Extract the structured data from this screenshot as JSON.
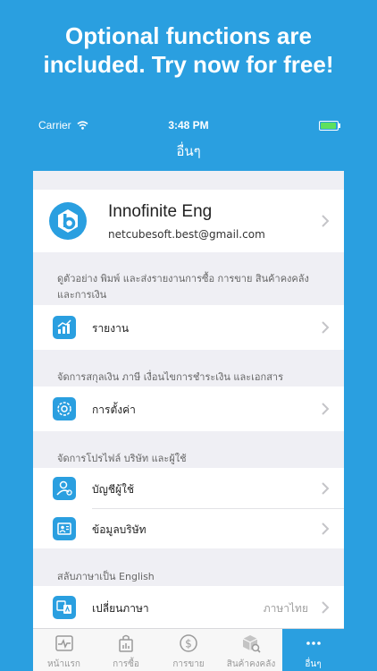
{
  "promo": {
    "line1": "Optional functions are",
    "line2": "included. Try now for free!"
  },
  "status_bar": {
    "carrier": "Carrier",
    "time": "3:48 PM"
  },
  "nav": {
    "title": "อื่นๆ"
  },
  "profile": {
    "name": "Innofinite Eng",
    "email": "netcubesoft.best@gmail.com",
    "avatar_icon": "b-logo-icon"
  },
  "sections": {
    "reports": {
      "label": "ดูตัวอย่าง พิมพ์ และส่งรายงานการซื้อ การขาย สินค้าคงคลัง และการเงิน",
      "rows": [
        {
          "title": "รายงาน",
          "icon": "chart-icon"
        }
      ]
    },
    "settings": {
      "label": "จัดการสกุลเงิน ภาษี เงื่อนไขการชำระเงิน และเอกสาร",
      "rows": [
        {
          "title": "การตั้งค่า",
          "icon": "gear-icon"
        }
      ]
    },
    "profiles": {
      "label": "จัดการโปรไฟล์ บริษัท และผู้ใช้",
      "rows": [
        {
          "title": "บัญชีผู้ใช้",
          "icon": "user-account-icon"
        },
        {
          "title": "ข้อมูลบริษัท",
          "icon": "company-info-icon"
        }
      ]
    },
    "language": {
      "label": "สลับภาษาเป็น English",
      "rows": [
        {
          "title": "เปลี่ยนภาษา",
          "value": "ภาษาไทย",
          "icon": "language-icon"
        }
      ]
    }
  },
  "tabs": [
    {
      "label": "หน้าแรก",
      "icon": "dashboard-icon",
      "active": false
    },
    {
      "label": "การซื้อ",
      "icon": "shopping-bag-icon",
      "active": false
    },
    {
      "label": "การขาย",
      "icon": "dollar-icon",
      "active": false
    },
    {
      "label": "สินค้าคงคลัง",
      "icon": "inventory-box-icon",
      "active": false
    },
    {
      "label": "อื่นๆ",
      "icon": "more-dots-icon",
      "active": true
    }
  ],
  "colors": {
    "brand": "#2a9fe0",
    "background": "#efeff4"
  }
}
